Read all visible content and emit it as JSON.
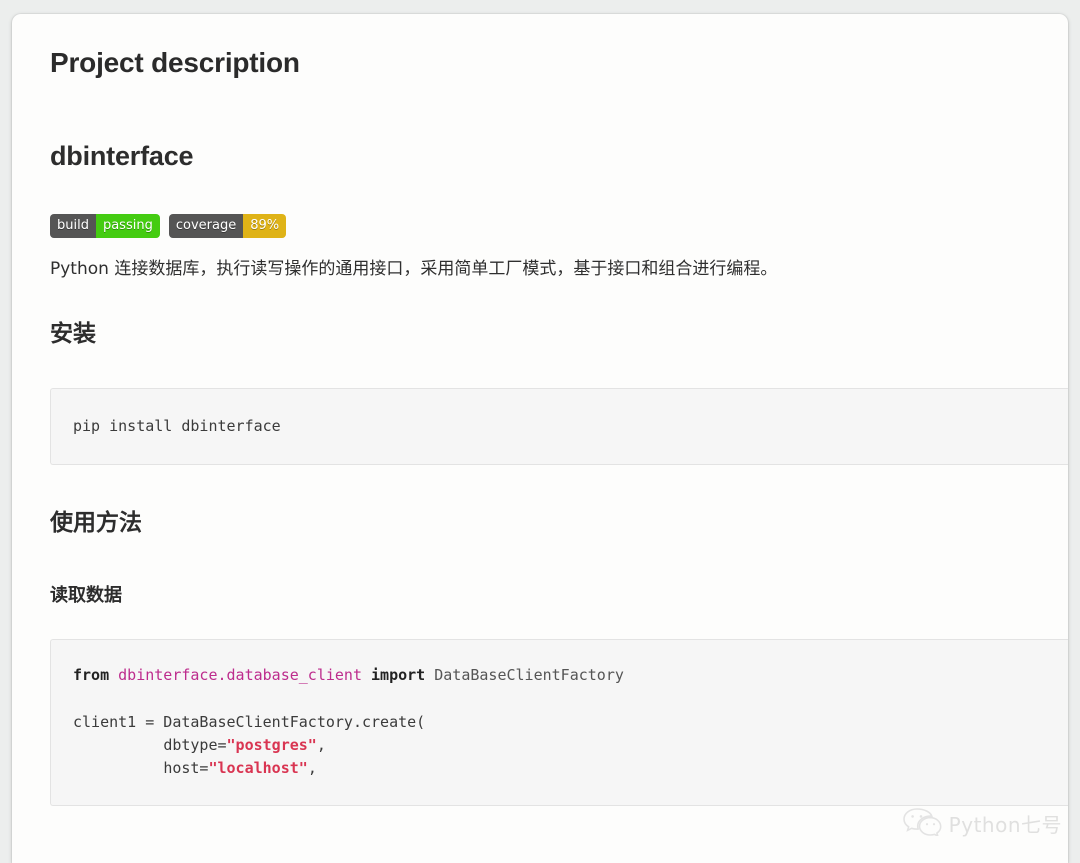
{
  "page": {
    "heading": "Project description",
    "project_title": "dbinterface"
  },
  "badges": [
    {
      "name": "build-badge",
      "label": "build",
      "value": "passing",
      "label_color": "#555555",
      "value_color": "#4c1"
    },
    {
      "name": "coverage-badge",
      "label": "coverage",
      "value": "89%",
      "label_color": "#555555",
      "value_color": "#dfb317"
    }
  ],
  "description": "Python 连接数据库，执行读写操作的通用接口，采用简单工厂模式，基于接口和组合进行编程。",
  "sections": {
    "install": {
      "heading": "安装",
      "code": "pip install dbinterface"
    },
    "usage": {
      "heading": "使用方法",
      "subheading": "读取数据"
    }
  },
  "python_code": {
    "line1": {
      "from": "from",
      "module": "dbinterface.database_client",
      "import": "import",
      "symbol": "DataBaseClientFactory"
    },
    "line3": "client1 = DataBaseClientFactory.create(",
    "line4_key": "dbtype=",
    "line4_val": "\"postgres\"",
    "line4_end": ",",
    "line5_key": "host=",
    "line5_val": "\"localhost\"",
    "line5_end": ","
  },
  "watermark": {
    "icon": "wechat-icon",
    "text": "Python七号"
  },
  "colors": {
    "page_background": "#eceeed",
    "card_background": "#fdfdfc",
    "code_background": "#f6f6f6",
    "code_border": "#e3e3e3",
    "text": "#2d2d2d",
    "string_token": "#d93552",
    "module_token": "#bd2c8d"
  }
}
